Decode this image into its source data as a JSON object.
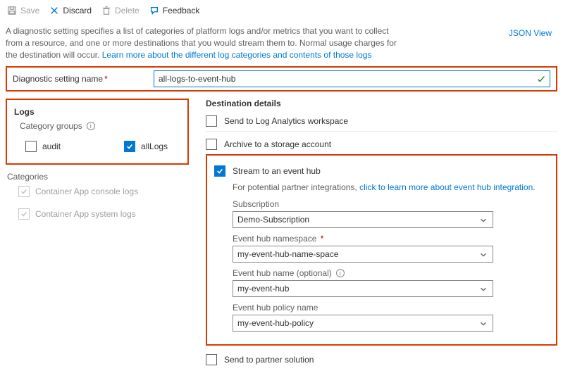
{
  "toolbar": {
    "save": "Save",
    "discard": "Discard",
    "delete": "Delete",
    "feedback": "Feedback"
  },
  "intro_part1": "A diagnostic setting specifies a list of categories of platform logs and/or metrics that you want to collect from a resource, and one or more destinations that you would stream them to. Normal usage charges for the destination will occur. ",
  "intro_link": "Learn more about the different log categories and contents of those logs",
  "json_view": "JSON View",
  "name_label": "Diagnostic setting name",
  "name_value": "all-logs-to-event-hub",
  "logs": {
    "title": "Logs",
    "cat_groups": "Category groups",
    "audit": "audit",
    "allLogs": "allLogs",
    "categories": "Categories",
    "cat1": "Container App console logs",
    "cat2": "Container App system logs"
  },
  "dest": {
    "title": "Destination details",
    "la": "Send to Log Analytics workspace",
    "storage": "Archive to a storage account",
    "eh": "Stream to an event hub",
    "partner_note": "For potential partner integrations, ",
    "partner_link": "click to learn more about event hub integration.",
    "sub_label": "Subscription",
    "sub_value": "Demo-Subscription",
    "ns_label": "Event hub namespace",
    "ns_value": "my-event-hub-name-space",
    "ehname_label": "Event hub name (optional)",
    "ehname_value": "my-event-hub",
    "policy_label": "Event hub policy name",
    "policy_value": "my-event-hub-policy",
    "partner": "Send to partner solution"
  }
}
